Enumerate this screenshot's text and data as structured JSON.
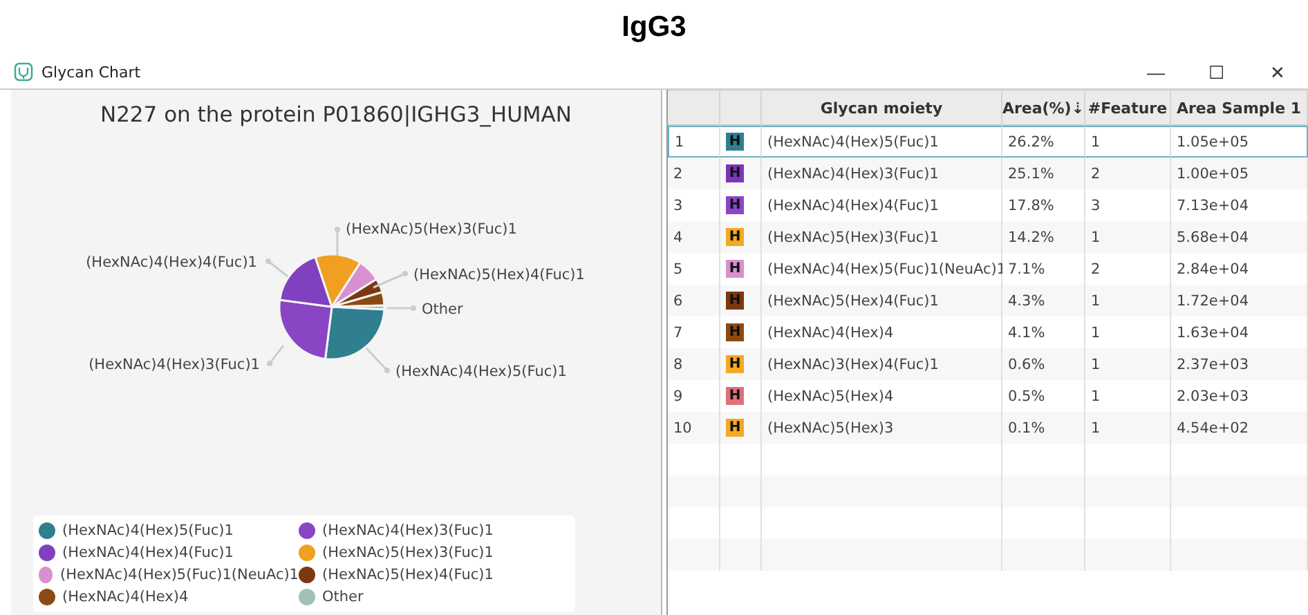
{
  "heading": "IgG3",
  "window": {
    "title": "Glycan Chart",
    "controls": [
      "—",
      "☐",
      "✕"
    ]
  },
  "chart": {
    "chart_data": {
      "type": "pie",
      "title": "N227 on the protein P01860|IGHG3_HUMAN",
      "categories": [
        "(HexNAc)4(Hex)5(Fuc)1",
        "(HexNAc)4(Hex)3(Fuc)1",
        "(HexNAc)4(Hex)4(Fuc)1",
        "(HexNAc)5(Hex)3(Fuc)1",
        "(HexNAc)4(Hex)5(Fuc)1(NeuAc)1",
        "(HexNAc)5(Hex)4(Fuc)1",
        "(HexNAc)4(Hex)4",
        "Other"
      ],
      "values": [
        26.2,
        25.1,
        17.8,
        14.2,
        7.1,
        4.3,
        4.1,
        1.2
      ],
      "colors": [
        "#2f7f90",
        "#8a45c4",
        "#8040c0",
        "#f0a020",
        "#d890d0",
        "#7a3810",
        "#8c4a12",
        "#a0c0b8"
      ],
      "annotations": [
        "(HexNAc)4(Hex)5(Fuc)1",
        "(HexNAc)4(Hex)3(Fuc)1",
        "(HexNAc)4(Hex)4(Fuc)1",
        "(HexNAc)5(Hex)3(Fuc)1",
        "(HexNAc)5(Hex)4(Fuc)1",
        "Other"
      ]
    }
  },
  "table": {
    "columns": [
      "",
      "",
      "Glycan moiety",
      "Area(%)⇣",
      "#Feature",
      "Area Sample 1"
    ],
    "rows": [
      {
        "index": "1",
        "badge": "H",
        "color": "#2f7f90",
        "moiety": "(HexNAc)4(Hex)5(Fuc)1",
        "area": "26.2%",
        "feature": "1",
        "sample": "1.05e+05",
        "selected": true
      },
      {
        "index": "2",
        "badge": "H",
        "color": "#7a35b8",
        "moiety": "(HexNAc)4(Hex)3(Fuc)1",
        "area": "25.1%",
        "feature": "2",
        "sample": "1.00e+05",
        "selected": false
      },
      {
        "index": "3",
        "badge": "H",
        "color": "#8a45c8",
        "moiety": "(HexNAc)4(Hex)4(Fuc)1",
        "area": "17.8%",
        "feature": "3",
        "sample": "7.13e+04",
        "selected": false
      },
      {
        "index": "4",
        "badge": "H",
        "color": "#f5a820",
        "moiety": "(HexNAc)5(Hex)3(Fuc)1",
        "area": "14.2%",
        "feature": "1",
        "sample": "5.68e+04",
        "selected": false
      },
      {
        "index": "5",
        "badge": "H",
        "color": "#d890d0",
        "moiety": "(HexNAc)4(Hex)5(Fuc)1(NeuAc)1",
        "area": "7.1%",
        "feature": "2",
        "sample": "2.84e+04",
        "selected": false
      },
      {
        "index": "6",
        "badge": "H",
        "color": "#7a3810",
        "moiety": "(HexNAc)5(Hex)4(Fuc)1",
        "area": "4.3%",
        "feature": "1",
        "sample": "1.72e+04",
        "selected": false
      },
      {
        "index": "7",
        "badge": "H",
        "color": "#8c4a12",
        "moiety": "(HexNAc)4(Hex)4",
        "area": "4.1%",
        "feature": "1",
        "sample": "1.63e+04",
        "selected": false
      },
      {
        "index": "8",
        "badge": "H",
        "color": "#f5a822",
        "moiety": "(HexNAc)3(Hex)4(Fuc)1",
        "area": "0.6%",
        "feature": "1",
        "sample": "2.37e+03",
        "selected": false
      },
      {
        "index": "9",
        "badge": "H",
        "color": "#e07078",
        "moiety": "(HexNAc)5(Hex)4",
        "area": "0.5%",
        "feature": "1",
        "sample": "2.03e+03",
        "selected": false
      },
      {
        "index": "10",
        "badge": "H",
        "color": "#f5a824",
        "moiety": "(HexNAc)5(Hex)3",
        "area": "0.1%",
        "feature": "1",
        "sample": "4.54e+02",
        "selected": false
      }
    ]
  }
}
